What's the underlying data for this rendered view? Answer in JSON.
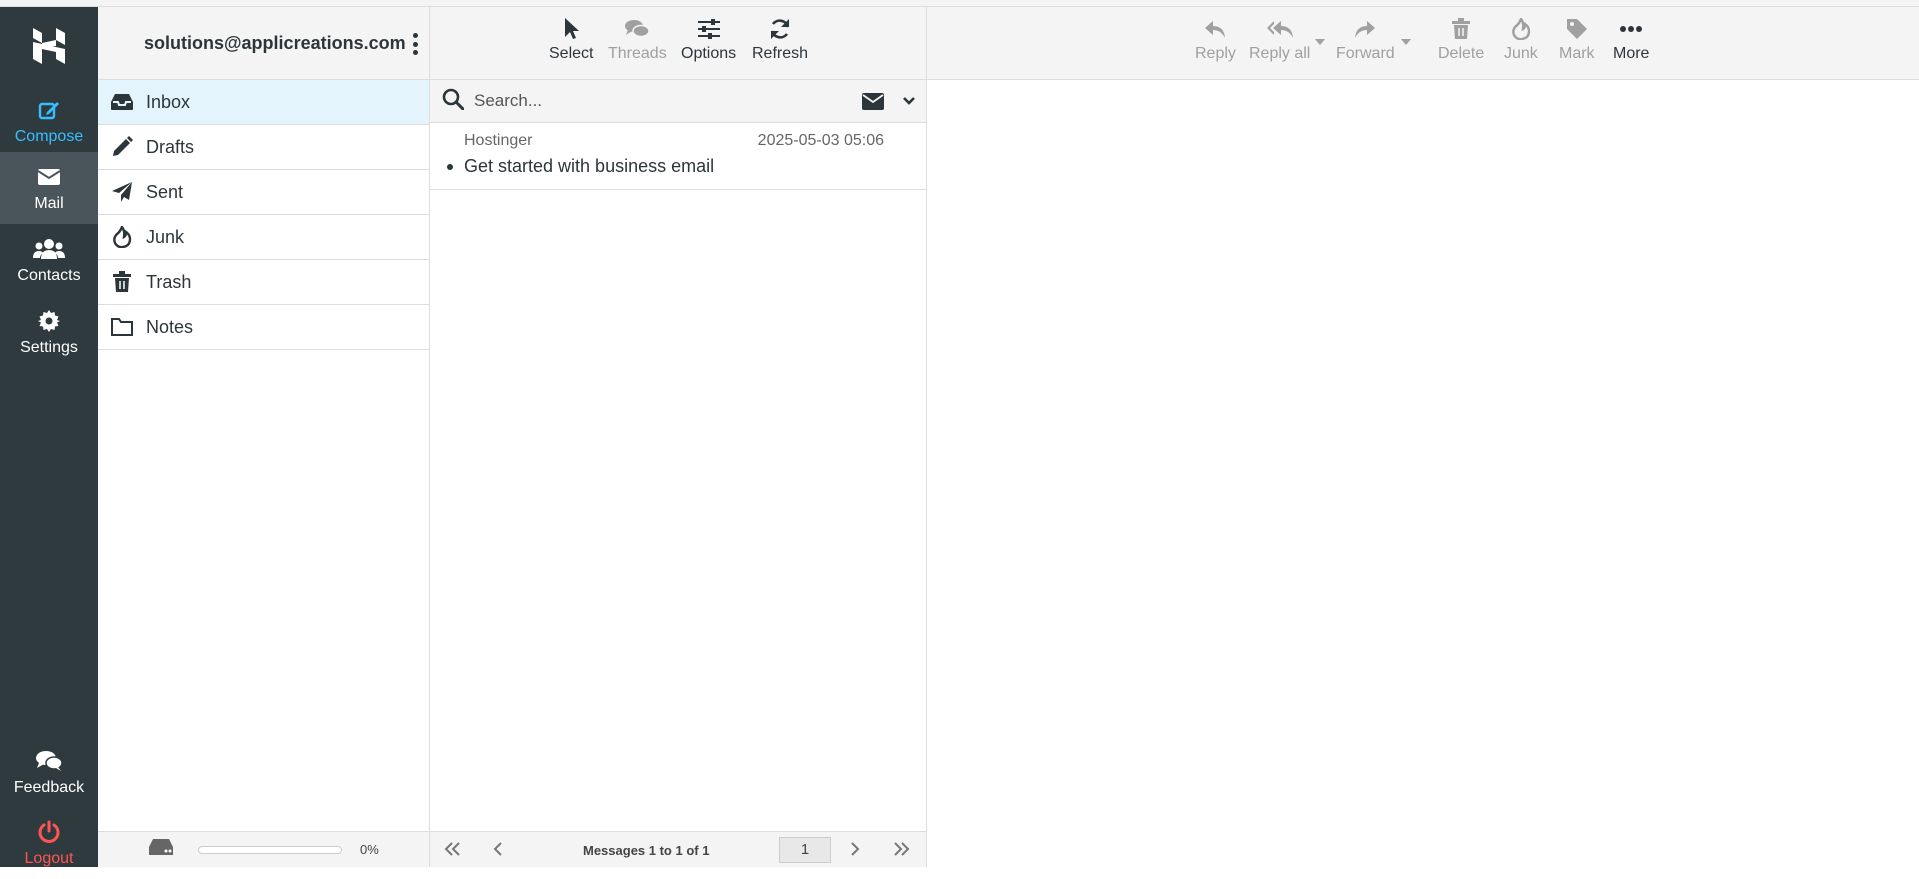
{
  "navbar": {
    "compose": "Compose",
    "mail": "Mail",
    "contacts": "Contacts",
    "settings": "Settings",
    "feedback": "Feedback",
    "logout": "Logout"
  },
  "account": {
    "email": "solutions@applicreations.com"
  },
  "folders": [
    {
      "label": "Inbox",
      "icon": "inbox-icon",
      "active": true
    },
    {
      "label": "Drafts",
      "icon": "pencil-icon"
    },
    {
      "label": "Sent",
      "icon": "paper-plane-icon"
    },
    {
      "label": "Junk",
      "icon": "fire-icon"
    },
    {
      "label": "Trash",
      "icon": "trash-icon"
    },
    {
      "label": "Notes",
      "icon": "folder-icon"
    }
  ],
  "quota": {
    "text": "0%",
    "fraction": 0
  },
  "list_toolbar": {
    "select": "Select",
    "threads": "Threads",
    "options": "Options",
    "refresh": "Refresh"
  },
  "search": {
    "placeholder": "Search..."
  },
  "messages": [
    {
      "from": "Hostinger",
      "date": "2025-05-03 05:06",
      "subject": "Get started with business email",
      "unread": true
    }
  ],
  "pager": {
    "text": "Messages 1 to 1 of 1",
    "page": "1"
  },
  "preview_toolbar": {
    "reply": "Reply",
    "reply_all": "Reply all",
    "forward": "Forward",
    "delete": "Delete",
    "junk": "Junk",
    "mark": "Mark",
    "more": "More"
  },
  "colors": {
    "navbar_bg": "#2f3a3f",
    "accent": "#37beff",
    "logout": "#ff5552",
    "selected_folder": "#e3f4fc"
  }
}
